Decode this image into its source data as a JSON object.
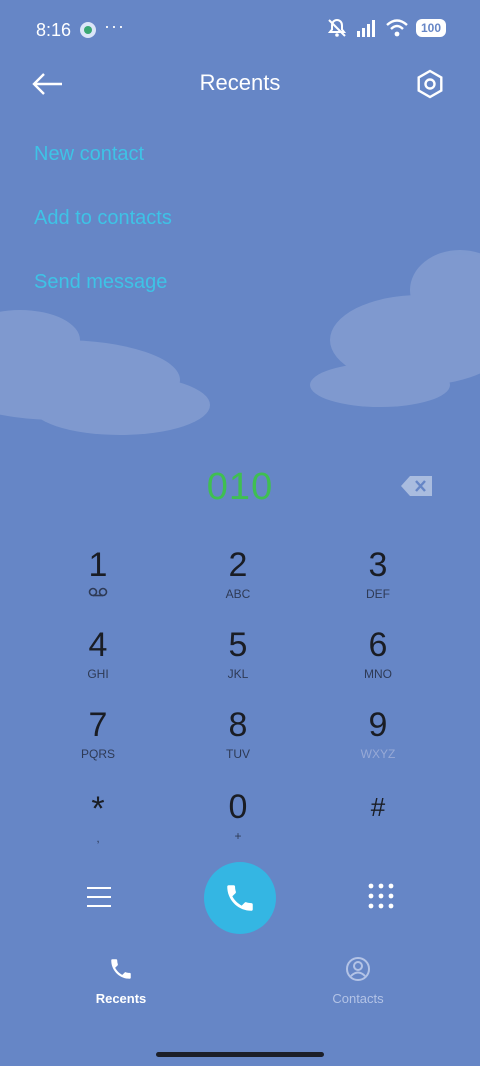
{
  "status_bar": {
    "time": "8:16",
    "more": "···",
    "battery": "100"
  },
  "header": {
    "title": "Recents"
  },
  "actions": [
    {
      "label": "New contact"
    },
    {
      "label": "Add to contacts"
    },
    {
      "label": "Send message"
    }
  ],
  "dialer": {
    "number": "010"
  },
  "keypad": [
    {
      "digit": "1",
      "sub": ""
    },
    {
      "digit": "2",
      "sub": "ABC"
    },
    {
      "digit": "3",
      "sub": "DEF"
    },
    {
      "digit": "4",
      "sub": "GHI"
    },
    {
      "digit": "5",
      "sub": "JKL"
    },
    {
      "digit": "6",
      "sub": "MNO"
    },
    {
      "digit": "7",
      "sub": "PQRS"
    },
    {
      "digit": "8",
      "sub": "TUV"
    },
    {
      "digit": "9",
      "sub": "WXYZ"
    },
    {
      "digit": "*",
      "sub": ","
    },
    {
      "digit": "0",
      "sub": "+"
    },
    {
      "digit": "#",
      "sub": ""
    }
  ],
  "nav": {
    "recents_label": "Recents",
    "contacts_label": "Contacts"
  },
  "colors": {
    "background": "#6686c6",
    "accent_link": "#3ec3e6",
    "number": "#3fbf52",
    "call_button": "#34b6e3"
  },
  "icons": {
    "back": "arrow-left-icon",
    "settings": "hexagon-settings-icon",
    "backspace": "backspace-icon",
    "voicemail": "voicemail-icon",
    "menu": "hamburger-menu-icon",
    "call": "phone-icon",
    "dialpad": "dialpad-icon",
    "recents": "phone-icon",
    "contacts": "person-circle-icon"
  }
}
